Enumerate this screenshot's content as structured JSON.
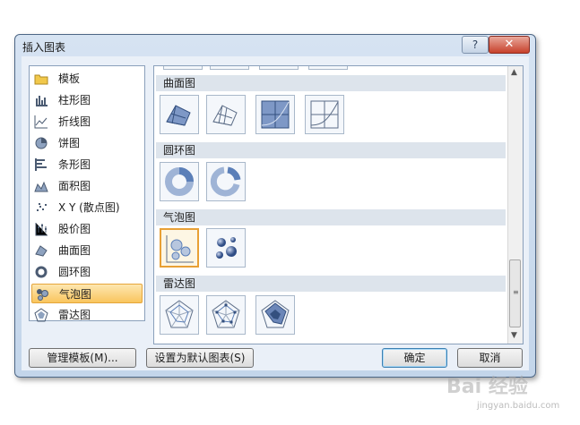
{
  "window": {
    "title": "插入图表",
    "help": "?",
    "close": "✕"
  },
  "sidebar": {
    "items": [
      {
        "label": "模板",
        "icon": "folder-icon"
      },
      {
        "label": "柱形图",
        "icon": "column-chart-icon"
      },
      {
        "label": "折线图",
        "icon": "line-chart-icon"
      },
      {
        "label": "饼图",
        "icon": "pie-chart-icon"
      },
      {
        "label": "条形图",
        "icon": "bar-chart-icon"
      },
      {
        "label": "面积图",
        "icon": "area-chart-icon"
      },
      {
        "label": "X Y (散点图)",
        "icon": "scatter-chart-icon"
      },
      {
        "label": "股价图",
        "icon": "stock-chart-icon"
      },
      {
        "label": "曲面图",
        "icon": "surface-chart-icon"
      },
      {
        "label": "圆环图",
        "icon": "doughnut-chart-icon"
      },
      {
        "label": "气泡图",
        "icon": "bubble-chart-icon",
        "selected": true
      },
      {
        "label": "雷达图",
        "icon": "radar-chart-icon"
      }
    ]
  },
  "gallery": {
    "sections": [
      {
        "title": "曲面图",
        "thumb_count": 4
      },
      {
        "title": "圆环图",
        "thumb_count": 2
      },
      {
        "title": "气泡图",
        "thumb_count": 2,
        "selected_index": 0
      },
      {
        "title": "雷达图",
        "thumb_count": 3
      }
    ]
  },
  "scrollbar": {
    "up": "▲",
    "down": "▼"
  },
  "buttons": {
    "manage_templates": "管理模板(M)...",
    "set_default": "设置为默认图表(S)",
    "ok": "确定",
    "cancel": "取消"
  },
  "watermark": {
    "brand": "Bai 经验",
    "url": "jingyan.baidu.com"
  },
  "colors": {
    "selection": "#f9c55e",
    "section_header": "#dde4ec",
    "chart_blue": "#5b7fb8"
  }
}
